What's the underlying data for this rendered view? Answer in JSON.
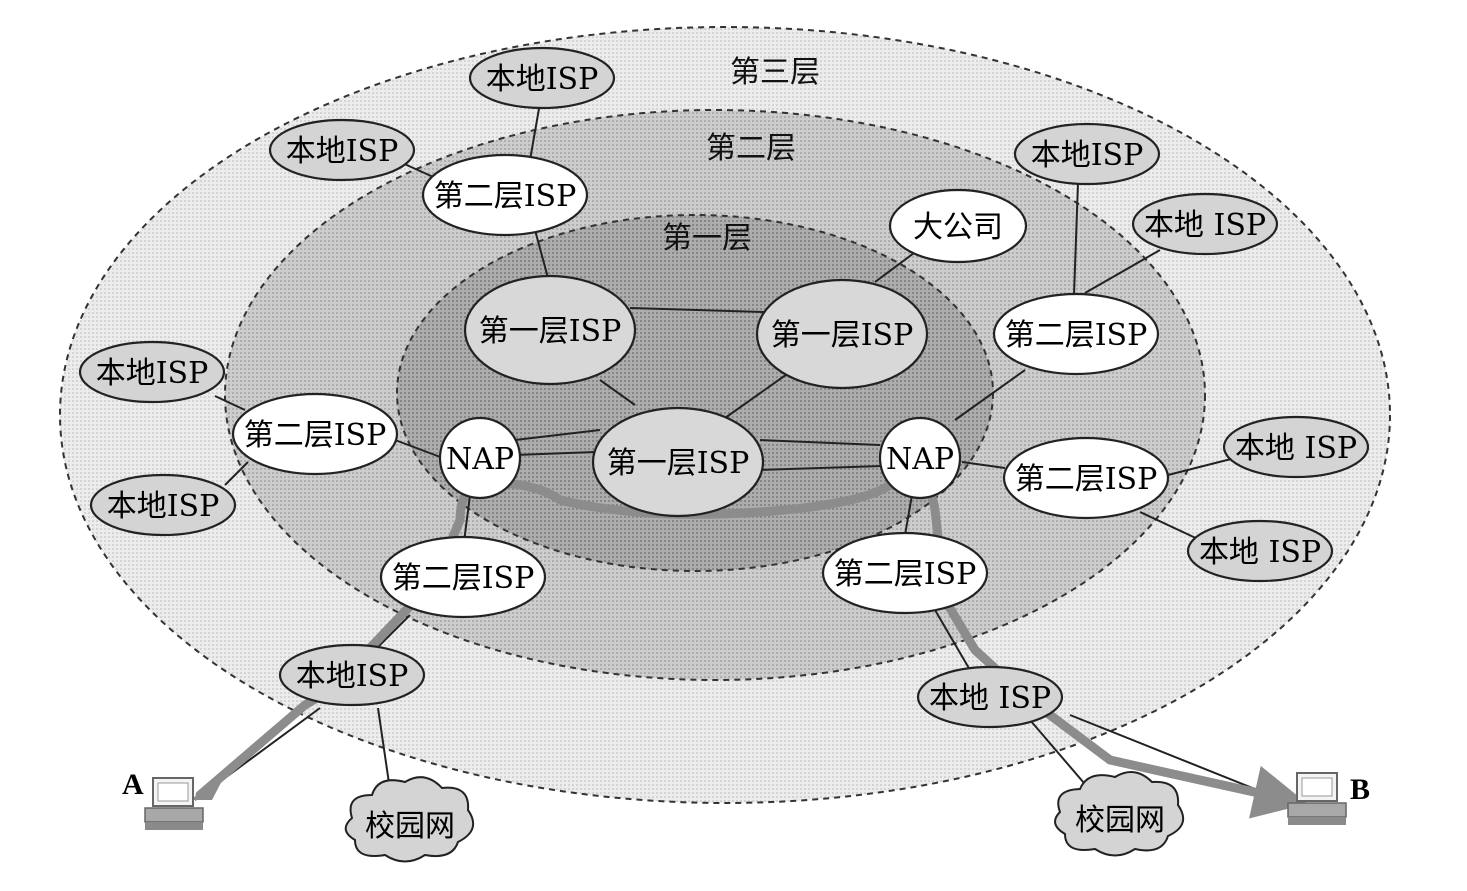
{
  "layers": {
    "third": "第三层",
    "second": "第二层",
    "first": "第一层"
  },
  "labels": {
    "local_isp": "本地ISP",
    "local_isp_spaced": "本地 ISP",
    "tier2_isp": "第二层ISP",
    "tier1_isp": "第一层ISP",
    "nap": "NAP",
    "big_company": "大公司",
    "campus_net": "校园网",
    "host_a": "A",
    "host_b": "B"
  },
  "colors": {
    "background": "#ffffff",
    "outer_layer_fill": "#e8e8e8",
    "middle_layer_fill": "#c9c9c9",
    "inner_layer_fill": "#a9a9a9",
    "node_white": "#ffffff",
    "node_gray": "#d4d4d4",
    "route_path": "#8c8c8c",
    "line": "#222222"
  }
}
